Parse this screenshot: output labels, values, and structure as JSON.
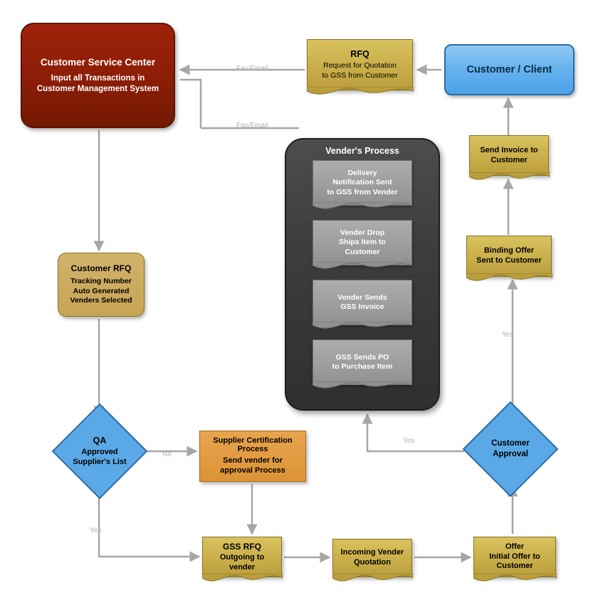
{
  "diagram": {
    "title": "GSS Procurement Process Flowchart",
    "colors": {
      "dark_red": "#8b1d06",
      "gold": "#cbb04b",
      "blue": "#69b3ee",
      "orange": "#dc9336",
      "vendor_panel": "#3d3d3d",
      "vendor_step": "#9e9e9e",
      "connector": "#a6a6a6"
    },
    "nodes": {
      "customer_service_center": {
        "title": "Customer Service Center",
        "body": "Input all Transactions in\nCustomer Management System"
      },
      "customer_client": {
        "title": "Customer / Client"
      },
      "rfq": {
        "title": "RFQ",
        "body": "Request for Quotation\nto GSS from Customer"
      },
      "send_invoice": {
        "body": "Send Invoice to\nCustomer"
      },
      "binding_offer": {
        "body": "Binding Offer\nSent to Customer"
      },
      "customer_rfq": {
        "title": "Customer RFQ",
        "body": "Tracking Number\nAuto Generated\nVenders Selected"
      },
      "qa": {
        "title": "QA",
        "body": "Approved\nSupplier's List"
      },
      "customer_approval": {
        "body": "Customer\nApproval"
      },
      "supplier_certification": {
        "title": "Supplier Certification\nProcess",
        "body": "Send vender for\napproval Process"
      },
      "gss_rfq": {
        "title": "GSS RFQ",
        "body": "Outgoing to\nvender"
      },
      "incoming_quotation": {
        "body": "Incoming Vender\nQuotation"
      },
      "offer": {
        "body": "Offer\nInitial Offer to\nCustomer"
      },
      "vendor_process": {
        "title": "Vender's Process",
        "steps": [
          "Delivery\nNotification Sent\nto GSS from Vender",
          "Vender Drop\nShips Item to\nCustomer",
          "Vender Sends\nGSS Invoice",
          "GSS Sends PO\nto Purchase Item"
        ]
      }
    },
    "edge_labels": {
      "fax_email_top": "Fax/Email",
      "fax_email_bottom": "Fax/Email",
      "qa_no": "No",
      "qa_yes": "Yes",
      "approval_yes_left": "Yes",
      "approval_yes_up": "Yes"
    }
  }
}
